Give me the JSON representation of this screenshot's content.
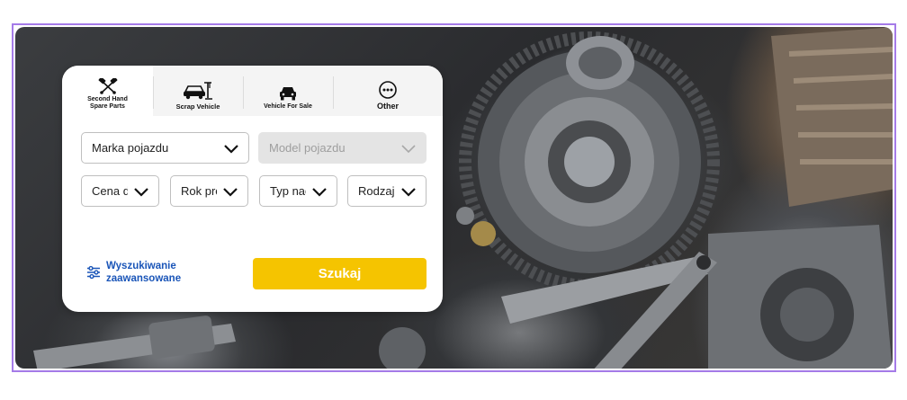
{
  "colors": {
    "frame_border": "#a57be8",
    "accent_button": "#f5c400",
    "link": "#1a55b8",
    "disabled_field": "#e4e4e4"
  },
  "hero": {
    "image": "car-parts-gears-photo"
  },
  "tabs": [
    {
      "line1": "Second Hand",
      "line2": "Spare Parts",
      "icon": "crossed-pistons-icon",
      "active": true
    },
    {
      "label": "Scrap Vehicle",
      "icon": "scrap-car-crane-icon"
    },
    {
      "label": "Vehicle For Sale",
      "icon": "car-front-icon"
    },
    {
      "label": "Other",
      "icon": "more-dots-circle-icon"
    }
  ],
  "filters": {
    "make": {
      "value": "Marka pojazdu",
      "icon": "chevron-down-icon"
    },
    "model": {
      "value": "Model pojazdu",
      "disabled": true,
      "icon": "chevron-down-icon"
    },
    "price": {
      "value": "Cena do"
    },
    "year": {
      "value": "Rok prod."
    },
    "body": {
      "value": "Typ nadwozia"
    },
    "type": {
      "value": "Rodzaj pojazdu"
    }
  },
  "advanced": {
    "line1": "Wyszukiwanie",
    "line2": "zaawansowane",
    "icon": "sliders-icon"
  },
  "search_button": {
    "label": "Szukaj"
  }
}
